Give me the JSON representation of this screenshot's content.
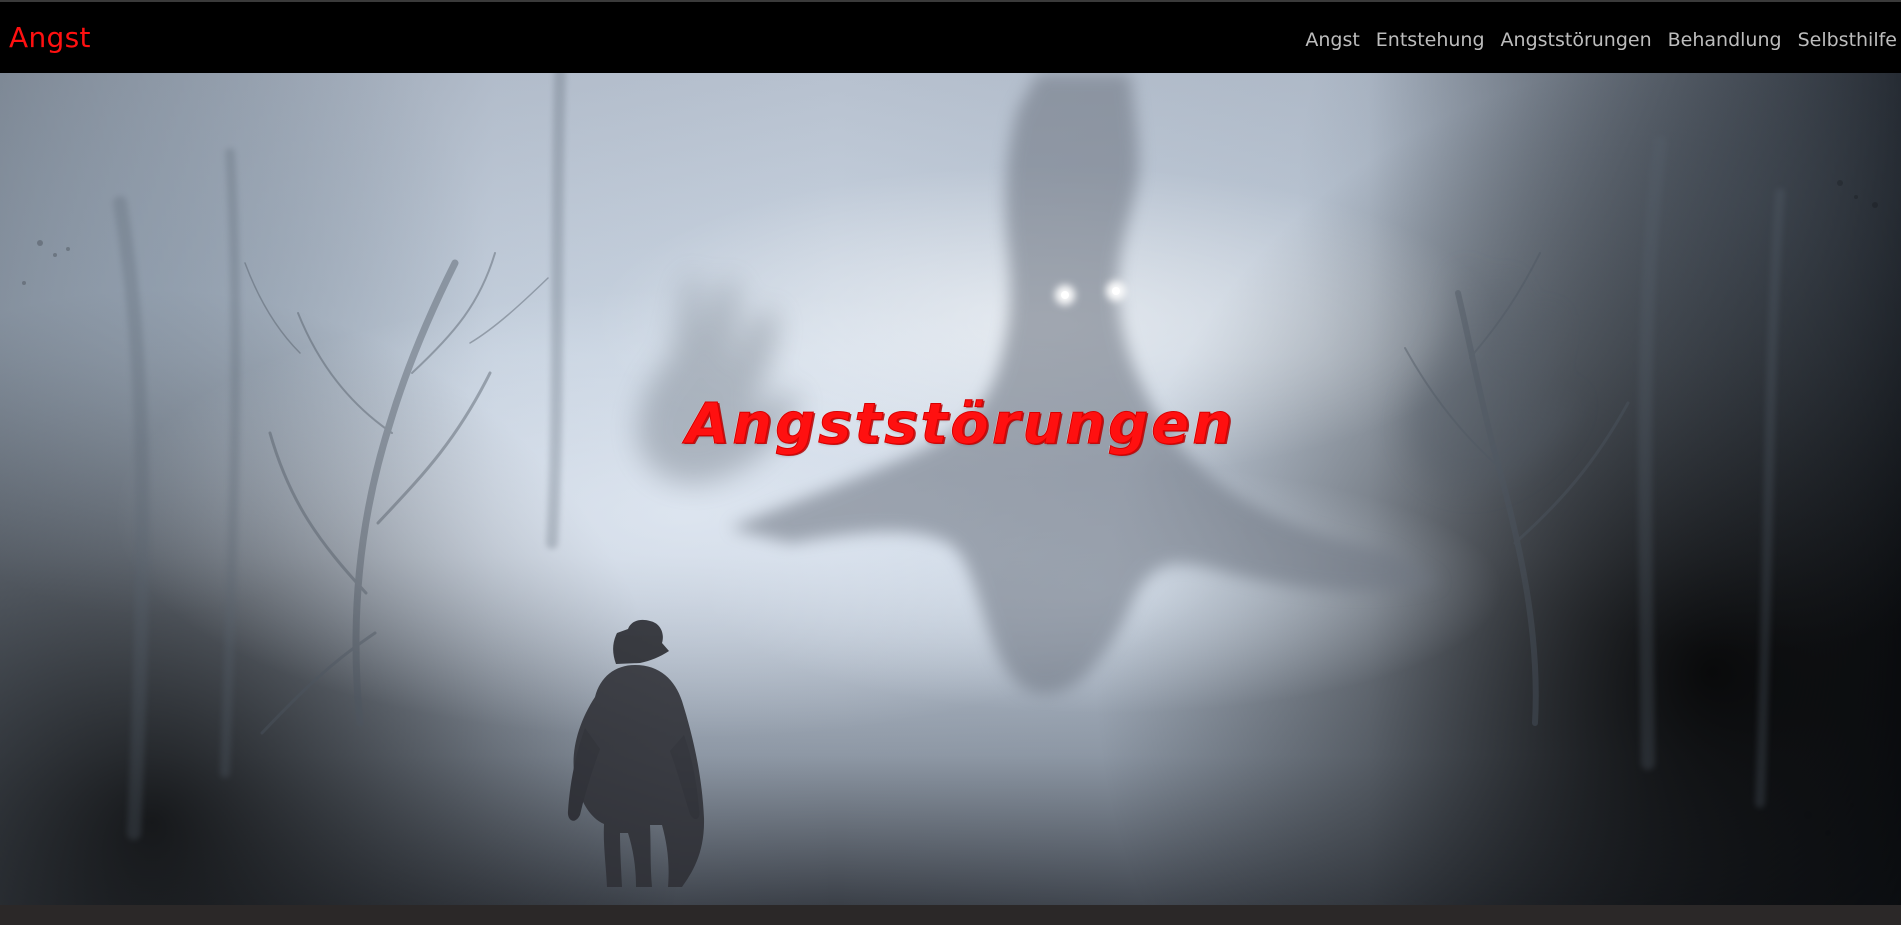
{
  "navbar": {
    "brand": "Angst",
    "links": [
      "Angst",
      "Entstehung",
      "Angststörungen",
      "Behandlung",
      "Selbsthilfe"
    ]
  },
  "hero": {
    "title": "Angststörungen",
    "image_icon": "misty-forest-with-ghost-and-walking-figure-icon"
  },
  "colors": {
    "navbar_background": "#000000",
    "brand": "#ff1010",
    "nav_link": "#bdbdbd",
    "hero_title": "#ff1010",
    "page_footer_band": "#2b2828"
  }
}
